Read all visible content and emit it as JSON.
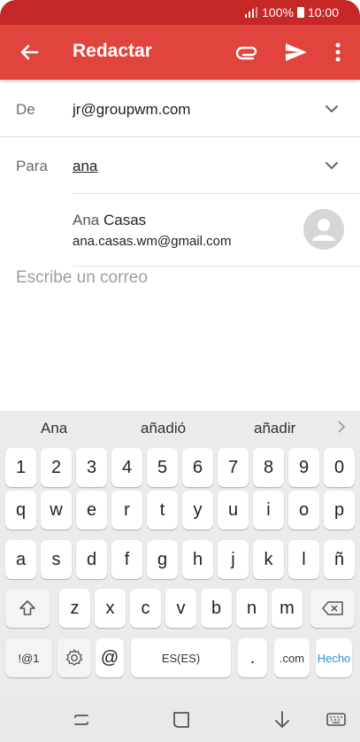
{
  "status_bar": {
    "battery": "100%",
    "time": "10:00"
  },
  "toolbar": {
    "title": "Redactar",
    "icons": [
      "arrow-back-icon",
      "attach-icon",
      "send-icon",
      "more-vert-icon"
    ]
  },
  "from": {
    "label": "De",
    "value": "jr@groupwm.com"
  },
  "to": {
    "label": "Para",
    "value": "ana"
  },
  "suggestion": {
    "first_name": "Ana",
    "last_name": "Casas",
    "email": "ana.casas.wm@gmail.com"
  },
  "compose": {
    "placeholder": "Escribe un correo"
  },
  "keyboard": {
    "suggestions": [
      "Ana",
      "añadió",
      "añadir"
    ],
    "row_numbers": [
      "1",
      "2",
      "3",
      "4",
      "5",
      "6",
      "7",
      "8",
      "9",
      "0"
    ],
    "row1": [
      "q",
      "w",
      "e",
      "r",
      "t",
      "y",
      "u",
      "i",
      "o",
      "p"
    ],
    "row2": [
      "a",
      "s",
      "d",
      "f",
      "g",
      "h",
      "j",
      "k",
      "l",
      "ñ"
    ],
    "row3": [
      "z",
      "x",
      "c",
      "v",
      "b",
      "n",
      "m"
    ],
    "symbols_label": "!@1",
    "at_label": "@",
    "space_label": "ES(ES)",
    "period_label": ".",
    "dotcom_label": ".com",
    "done_label": "Hecho"
  },
  "colors": {
    "appbar": "#e0443c",
    "statusbar": "#c62828",
    "done": "#2a8fd0"
  }
}
